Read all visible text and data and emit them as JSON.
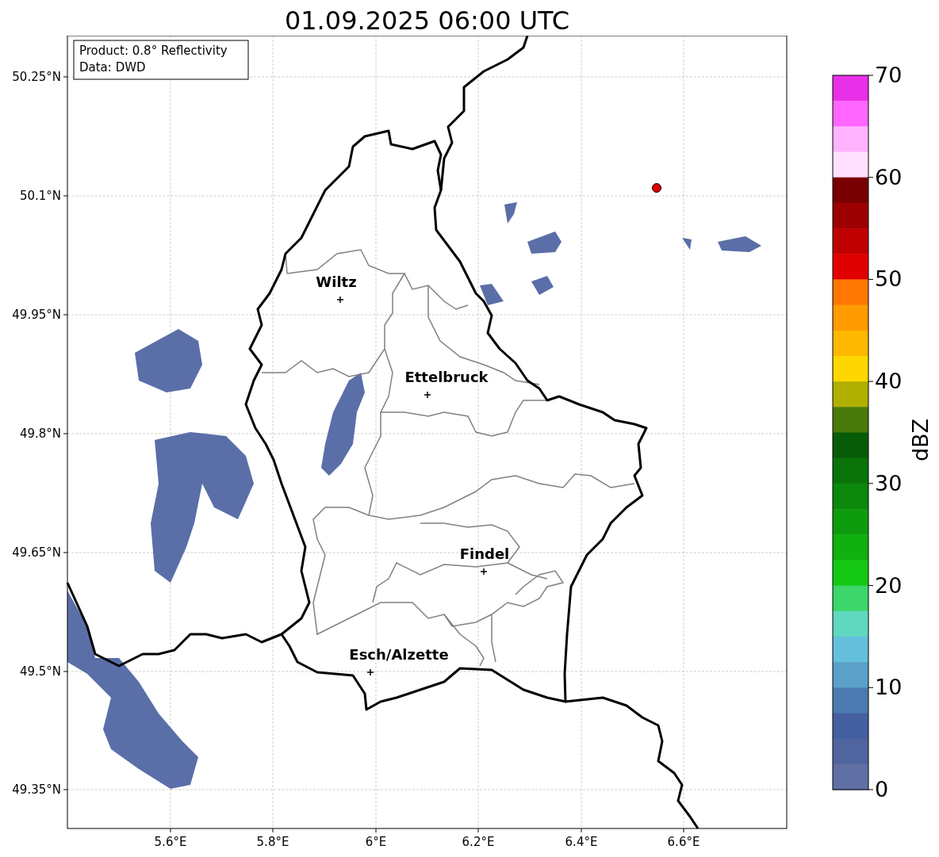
{
  "title": "01.09.2025 06:00 UTC",
  "info_box": {
    "lines": [
      "Product: 0.8° Reflectivity",
      "Data: DWD"
    ]
  },
  "map": {
    "x_ticks": [
      "5.6°E",
      "5.8°E",
      "6°E",
      "6.2°E",
      "6.4°E",
      "6.6°E"
    ],
    "y_ticks": [
      "50.25°N",
      "50.1°N",
      "49.95°N",
      "49.8°N",
      "49.65°N",
      "49.5°N",
      "49.35°N"
    ],
    "cities": [
      {
        "name": "Wiltz"
      },
      {
        "name": "Ettelbruck"
      },
      {
        "name": "Findel"
      },
      {
        "name": "Esch/Alzette"
      }
    ]
  },
  "colorbar": {
    "label": "dBZ",
    "ticks": [
      "70",
      "60",
      "50",
      "40",
      "30",
      "20",
      "10",
      "0"
    ],
    "bins": [
      {
        "color": "#e930e9"
      },
      {
        "color": "#ff66ff"
      },
      {
        "color": "#ffb3ff"
      },
      {
        "color": "#ffe0ff"
      },
      {
        "color": "#780000"
      },
      {
        "color": "#9c0000"
      },
      {
        "color": "#c00000"
      },
      {
        "color": "#e00000"
      },
      {
        "color": "#ff7700"
      },
      {
        "color": "#ff9a00"
      },
      {
        "color": "#ffb800"
      },
      {
        "color": "#ffd700"
      },
      {
        "color": "#b0b000"
      },
      {
        "color": "#487a0a"
      },
      {
        "color": "#085c08"
      },
      {
        "color": "#0a730a"
      },
      {
        "color": "#0c880c"
      },
      {
        "color": "#0e9c0e"
      },
      {
        "color": "#10b010"
      },
      {
        "color": "#14c814"
      },
      {
        "color": "#3cd66a"
      },
      {
        "color": "#60d8c0"
      },
      {
        "color": "#64c0dc"
      },
      {
        "color": "#5aa0c8"
      },
      {
        "color": "#4a7ab0"
      },
      {
        "color": "#4460a0"
      },
      {
        "color": "#5064a0"
      },
      {
        "color": "#6070a4"
      }
    ]
  }
}
